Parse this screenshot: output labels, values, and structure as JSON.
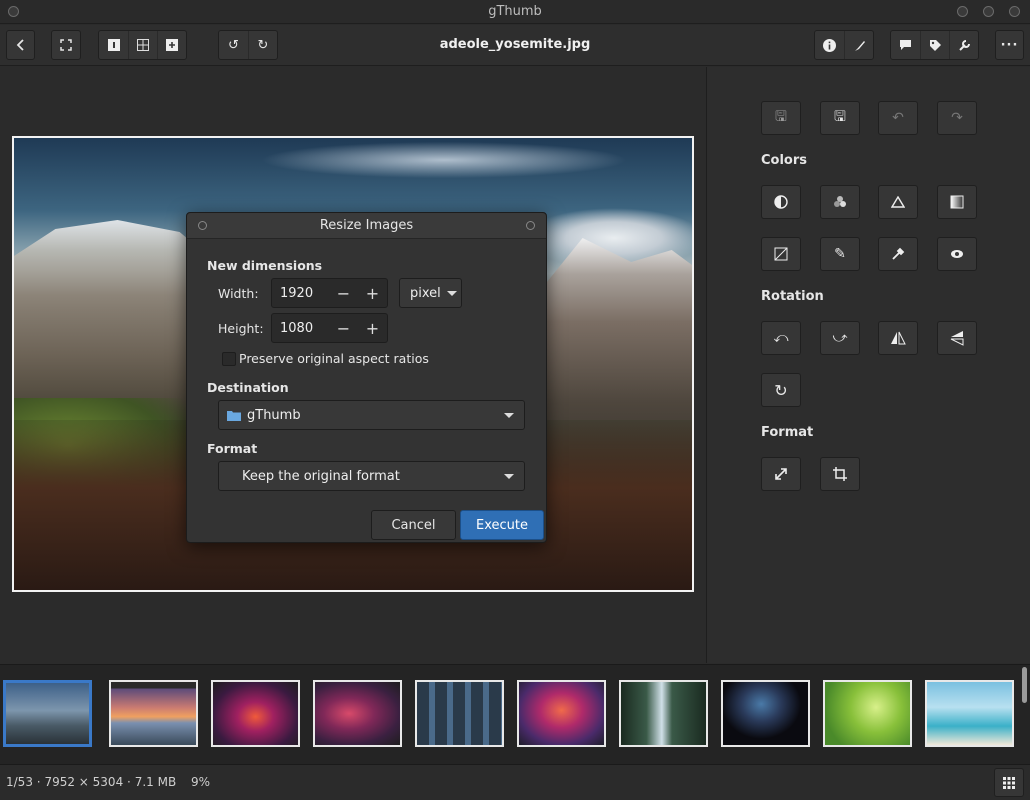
{
  "window": {
    "title": "gThumb"
  },
  "toolbar": {
    "document_title": "adeole_yosemite.jpg",
    "icons": [
      "back-icon",
      "fullscreen-icon",
      "view-single-icon",
      "view-grid-icon",
      "add-icon",
      "rotate-left-icon",
      "rotate-right-icon",
      "info-icon",
      "edit-brush-icon",
      "comment-icon",
      "tag-icon",
      "tools-wrench-icon",
      "menu-more-icon"
    ]
  },
  "right_panel": {
    "sections": {
      "colors": "Colors",
      "rotation": "Rotation",
      "format": "Format"
    }
  },
  "dialog": {
    "title": "Resize Images",
    "new_dimensions_label": "New dimensions",
    "width_label": "Width:",
    "width_value": "1920",
    "height_label": "Height:",
    "height_value": "1080",
    "minus": "−",
    "plus": "+",
    "unit": "pixel",
    "preserve_label": "Preserve original aspect ratios",
    "preserve_checked": false,
    "destination_label": "Destination",
    "destination_value": "gThumb",
    "format_label": "Format",
    "format_value": "Keep the original format",
    "cancel_label": "Cancel",
    "execute_label": "Execute"
  },
  "statusbar": {
    "position": "1/53",
    "sep1": "·",
    "dimensions": "7952 × 5304",
    "sep2": "·",
    "filesize": "7.1 MB",
    "zoom": "9%"
  },
  "colors": {
    "accent": "#2f6fb5",
    "selection": "#3a79c8"
  }
}
